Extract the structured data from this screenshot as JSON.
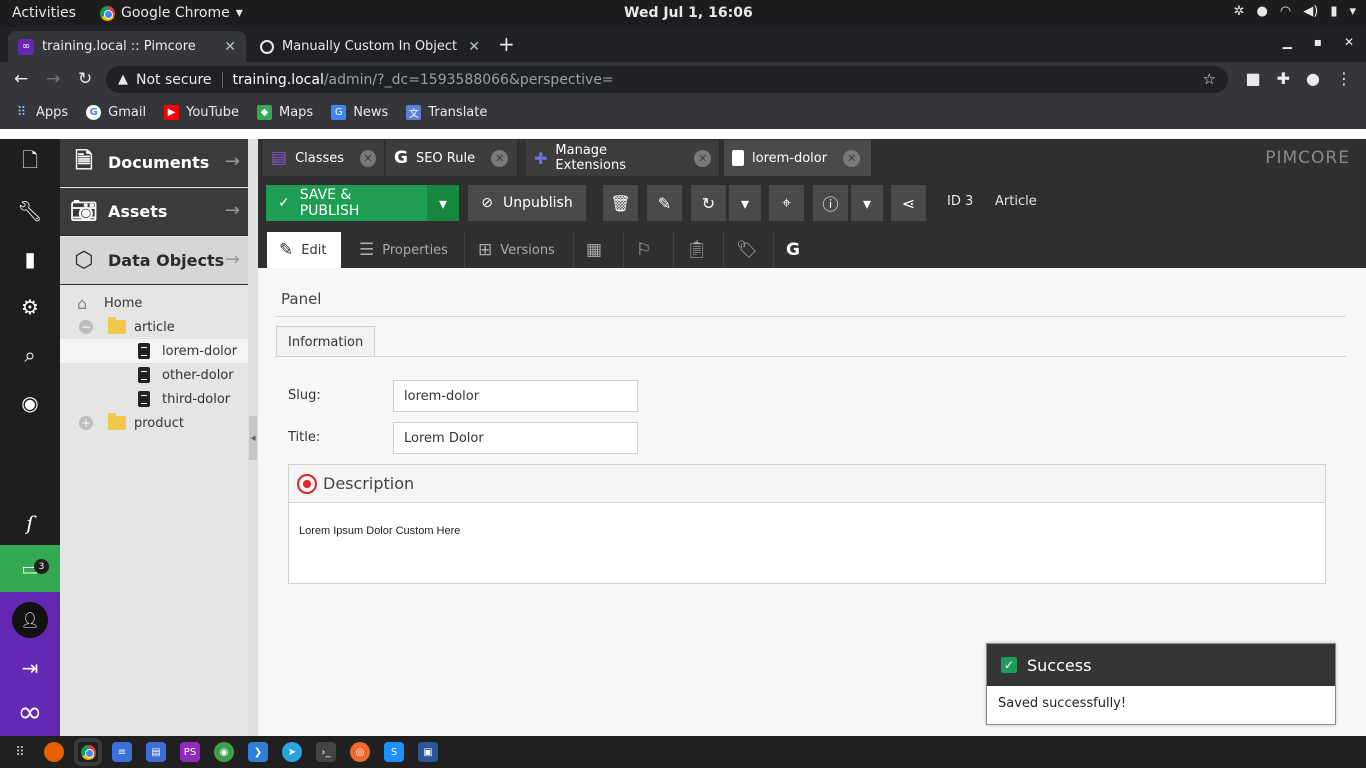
{
  "system": {
    "activities": "Activities",
    "app_name": "Google Chrome",
    "clock": "Wed Jul  1, 16:06"
  },
  "browser": {
    "tabs": [
      {
        "title": "training.local :: Pimcore",
        "active": true
      },
      {
        "title": "Manually Custom In Object",
        "active": false
      }
    ],
    "address": {
      "security": "Not secure",
      "host": "training.local",
      "path": "/admin/?_dc=1593588066&perspective="
    },
    "bookmarks": [
      "Apps",
      "Gmail",
      "YouTube",
      "Maps",
      "News",
      "Translate"
    ]
  },
  "sidebar": {
    "sections": [
      {
        "label": "Documents",
        "icon": "document-icon"
      },
      {
        "label": "Assets",
        "icon": "camera-icon"
      },
      {
        "label": "Data Objects",
        "icon": "cube-icon"
      }
    ],
    "notifications_badge": "3"
  },
  "tree": {
    "home": "Home",
    "folders": [
      {
        "label": "article",
        "expanded": true,
        "children": [
          "lorem-dolor",
          "other-dolor",
          "third-dolor"
        ]
      },
      {
        "label": "product",
        "expanded": false
      }
    ]
  },
  "tabs": [
    {
      "label": "Classes"
    },
    {
      "label": "SEO Rule"
    },
    {
      "label": "Manage Extensions"
    },
    {
      "label": "lorem-dolor"
    }
  ],
  "brand": "PIMCORE",
  "toolbar": {
    "save_publish": "SAVE & PUBLISH",
    "unpublish": "Unpublish",
    "id_label": "ID 3",
    "class_label": "Article"
  },
  "edit_tabs": [
    {
      "label": "Edit"
    },
    {
      "label": "Properties"
    },
    {
      "label": "Versions"
    }
  ],
  "form": {
    "panel_title": "Panel",
    "tab": "Information",
    "slug_label": "Slug:",
    "slug_value": "lorem-dolor",
    "title_label": "Title:",
    "title_value": "Lorem Dolor",
    "description_label": "Description",
    "description_value": "Lorem Ipsum Dolor Custom Here"
  },
  "toast": {
    "title": "Success",
    "message": "Saved successfully!"
  },
  "colors": {
    "accent_green": "#1f9d55",
    "pimcore_purple": "#6428b4",
    "toolbar_dark": "#2f2f2f"
  }
}
